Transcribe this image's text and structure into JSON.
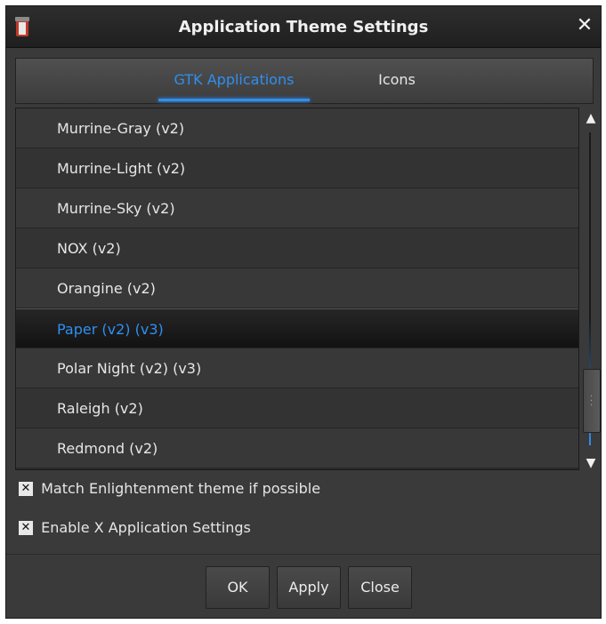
{
  "window": {
    "title": "Application Theme Settings",
    "close_label": "✕",
    "app_icon": "theme-jar-icon"
  },
  "tabs": [
    {
      "label": "GTK Applications",
      "active": true
    },
    {
      "label": "Icons",
      "active": false
    }
  ],
  "theme_list": {
    "items": [
      {
        "label": "Murrine-Gray (v2)",
        "selected": false
      },
      {
        "label": "Murrine-Light (v2)",
        "selected": false
      },
      {
        "label": "Murrine-Sky (v2)",
        "selected": false
      },
      {
        "label": "NOX (v2)",
        "selected": false
      },
      {
        "label": "Orangine (v2)",
        "selected": false
      },
      {
        "label": "Paper (v2) (v3)",
        "selected": true
      },
      {
        "label": "Polar Night (v2) (v3)",
        "selected": false
      },
      {
        "label": "Raleigh (v2)",
        "selected": false
      },
      {
        "label": "Redmond (v2)",
        "selected": false
      }
    ]
  },
  "scrollbar": {
    "up_icon": "chevron-up-icon",
    "down_icon": "chevron-down-icon"
  },
  "options": {
    "match_theme": {
      "label": "Match Enlightenment theme if possible",
      "checked": true
    },
    "enable_x_settings": {
      "label": "Enable X Application Settings",
      "checked": true
    }
  },
  "buttons": {
    "ok": "OK",
    "apply": "Apply",
    "close": "Close"
  },
  "colors": {
    "accent": "#2f8ff0",
    "background": "#3a3a3a",
    "titlebar": "#1f1f1f"
  }
}
